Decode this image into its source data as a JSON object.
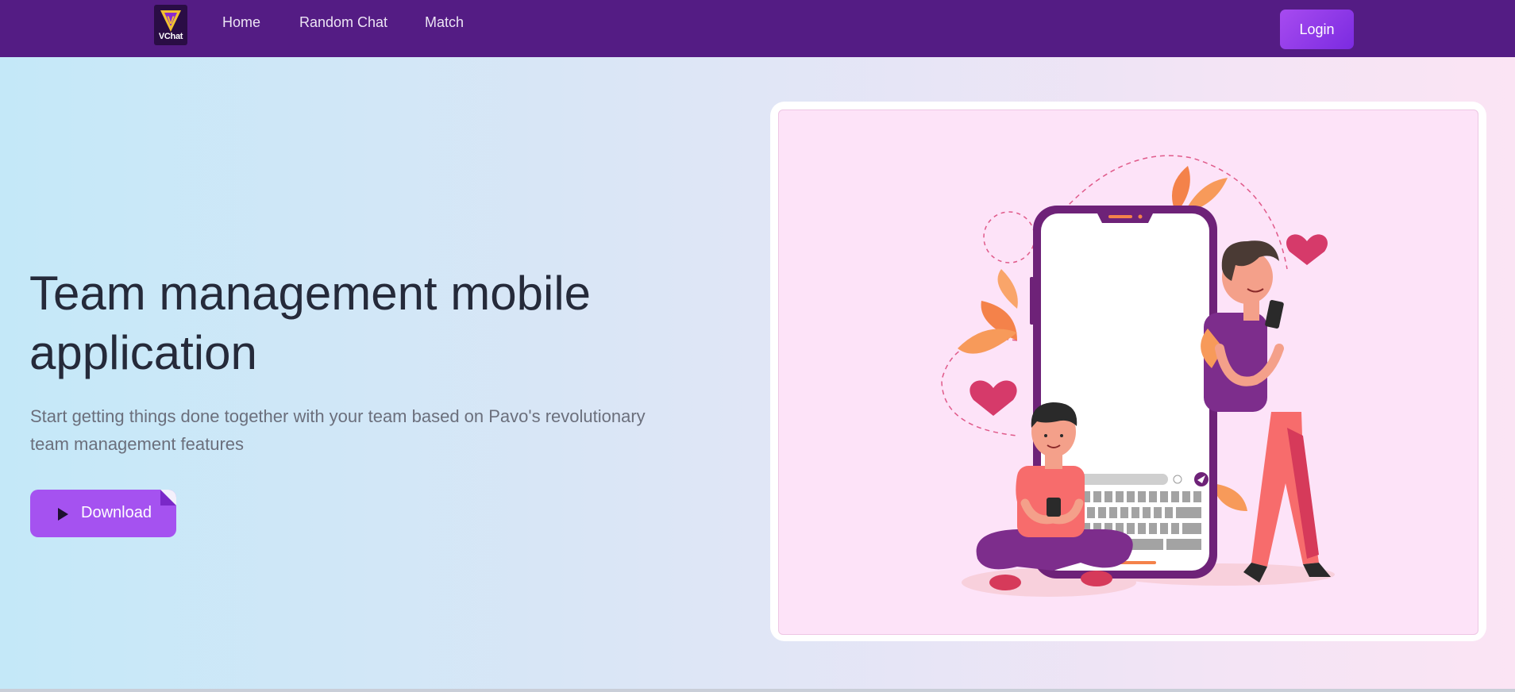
{
  "nav": {
    "logo_text": "VChat",
    "links": [
      "Home",
      "Random Chat",
      "Match"
    ],
    "login_label": "Login"
  },
  "hero": {
    "title": "Team management mobile application",
    "subtitle": "Start getting things done together with your team based on Pavo's revolutionary team management features",
    "download_label": "Download"
  },
  "colors": {
    "navbar": "#541c84",
    "accent": "#a552f0",
    "title_text": "#252a3a"
  },
  "icons": {
    "download": "play-icon",
    "send": "send-icon"
  }
}
